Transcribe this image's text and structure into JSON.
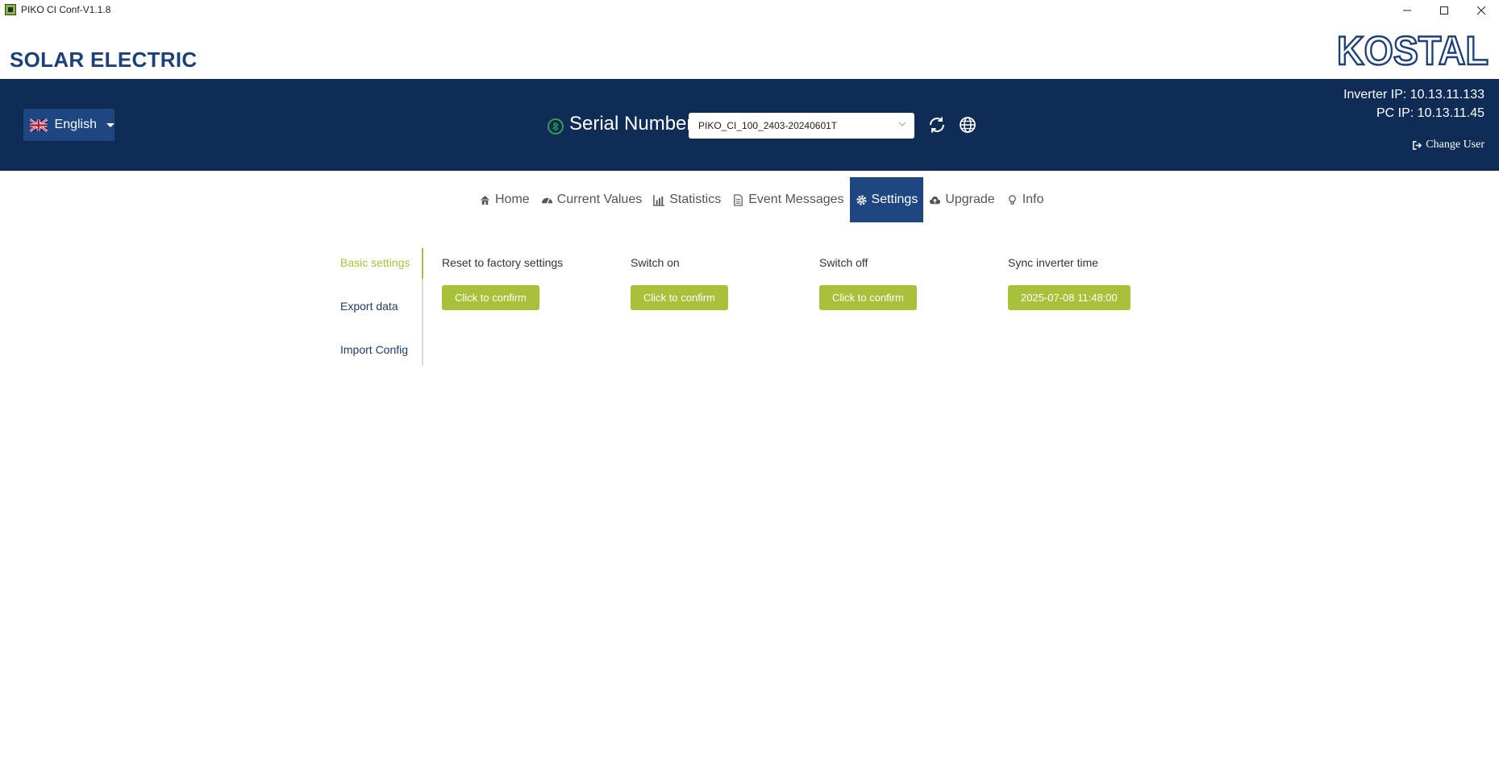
{
  "window": {
    "title": "PIKO CI Conf-V1.1.8"
  },
  "brand": {
    "title": "SOLAR ELECTRIC",
    "logo_text": "KOSTAL"
  },
  "header": {
    "language": "English",
    "serial_label": "Serial Number:",
    "serial_value": "PIKO_CI_100_2403-20240601T",
    "inverter_ip": "Inverter IP: 10.13.11.133",
    "pc_ip": "PC IP: 10.13.11.45",
    "change_user": "Change User"
  },
  "nav": {
    "items": [
      {
        "label": "Home",
        "icon": "home-icon"
      },
      {
        "label": "Current Values",
        "icon": "dashboard-icon"
      },
      {
        "label": "Statistics",
        "icon": "bar-chart-icon"
      },
      {
        "label": "Event Messages",
        "icon": "document-icon"
      },
      {
        "label": "Settings",
        "icon": "gear-icon"
      },
      {
        "label": "Upgrade",
        "icon": "cloud-upload-icon"
      },
      {
        "label": "Info",
        "icon": "lightbulb-icon"
      }
    ],
    "active": "Settings"
  },
  "sidebar": {
    "items": [
      {
        "label": "Basic settings"
      },
      {
        "label": "Export data"
      },
      {
        "label": "Import Config"
      }
    ],
    "active": "Basic settings"
  },
  "settings": {
    "reset": {
      "label": "Reset to factory settings",
      "button": "Click to confirm"
    },
    "switch_on": {
      "label": "Switch on",
      "button": "Click to confirm"
    },
    "switch_off": {
      "label": "Switch off",
      "button": "Click to confirm"
    },
    "sync_time": {
      "label": "Sync inverter time",
      "button": "2025-07-08 11:48:00"
    }
  },
  "colors": {
    "navy": "#0f2c57",
    "nav_active": "#1e4680",
    "accent_green": "#a8c03a",
    "brand_blue": "#1d3f7a"
  }
}
